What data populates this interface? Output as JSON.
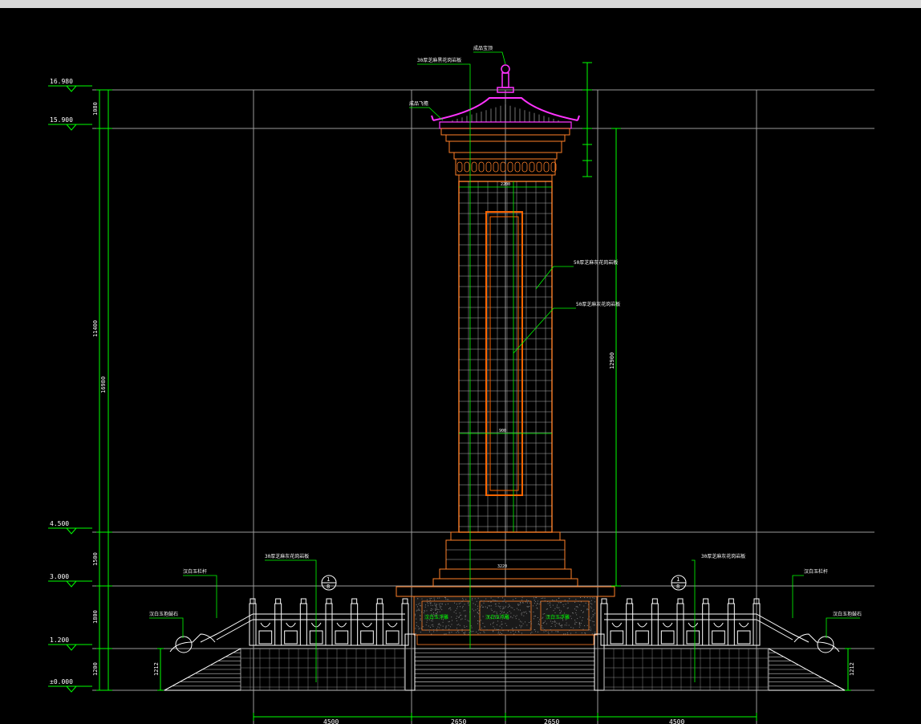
{
  "colors": {
    "background": "#000000",
    "dimension": "#00ff00",
    "stone": "#ff7f27",
    "roof": "#ff33ff",
    "grid": "#c0c0c0"
  },
  "elevations": [
    {
      "label": "16.980"
    },
    {
      "label": "15.900"
    },
    {
      "label": "4.500"
    },
    {
      "label": "3.000"
    },
    {
      "label": "1.200"
    },
    {
      "label": "±0.000"
    }
  ],
  "left_dims": {
    "total": "16980",
    "segments": [
      "1080",
      "11400",
      "1500",
      "1800",
      "1200"
    ],
    "stair_height": "1212"
  },
  "right_dims": {
    "shaft": "12900",
    "stair_height": "1212"
  },
  "bottom_dims": [
    "4500",
    "2650",
    "2650",
    "4500"
  ],
  "callouts": {
    "finial": "成品宝顶",
    "top_band": "30厚芝麻黑花岗岩板",
    "eave": "成品飞檐",
    "shaft_cladding": "50厚芝麻灰花岗岩板",
    "inscription_panel": "50厚芝麻灰花岗岩板",
    "base_left": "30厚芝麻灰花岗岩板",
    "base_right": "30厚芝麻灰花岗岩板",
    "rail_left": "汉白玉栏杆",
    "rail_right": "汉白玉栏杆",
    "drum_left": "汉白玉抱鼓石",
    "drum_right": "汉白玉抱鼓石",
    "panel_left": "汉白玉浮雕",
    "panel_center": "汉白玉浮雕",
    "panel_right": "汉白玉浮雕",
    "section_num": "1",
    "section_sheet": "8"
  },
  "small_dims": {
    "shaft_width": "2200",
    "panel_mid": "900",
    "base_width": "3220"
  }
}
